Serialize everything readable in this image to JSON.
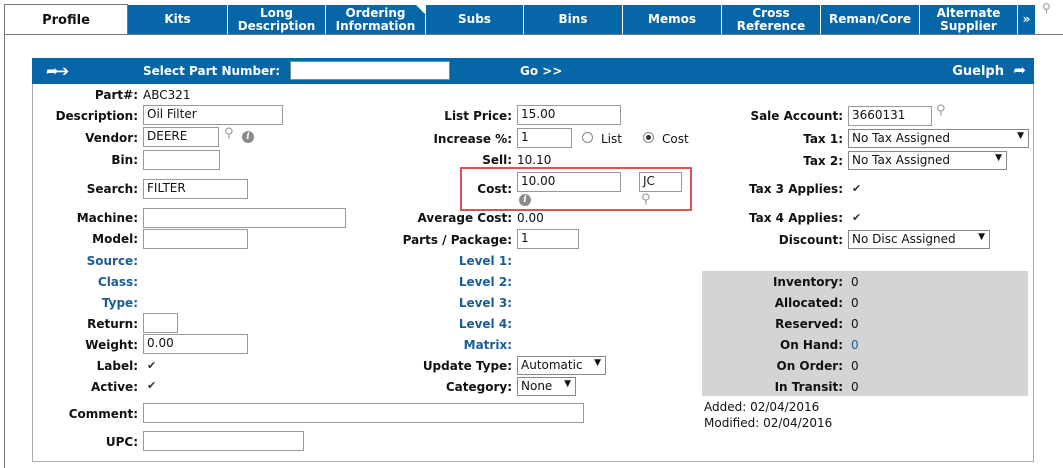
{
  "tabs": [
    {
      "label": "Profile",
      "active": true
    },
    {
      "label": "Kits"
    },
    {
      "line1": "Long",
      "line2": "Description"
    },
    {
      "line1": "Ordering",
      "line2": "Information"
    },
    {
      "label": "Subs"
    },
    {
      "label": "Bins"
    },
    {
      "label": "Memos"
    },
    {
      "line1": "Cross",
      "line2": "Reference"
    },
    {
      "label": "Reman/Core"
    },
    {
      "line1": "Alternate",
      "line2": "Supplier"
    },
    {
      "label": "»"
    }
  ],
  "bar": {
    "select_label": "Select Part Number:",
    "select_value": "",
    "go_label": "Go >>",
    "location": "Guelph"
  },
  "left": {
    "part_label": "Part#:",
    "part_value": "ABC321",
    "description_label": "Description:",
    "description_value": "Oil Filter",
    "vendor_label": "Vendor:",
    "vendor_value": "DEERE",
    "bin_label": "Bin:",
    "bin_value": "",
    "search_label": "Search:",
    "search_value": "FILTER",
    "machine_label": "Machine:",
    "machine_value": "",
    "model_label": "Model:",
    "model_value": "",
    "source_label": "Source:",
    "class_label": "Class:",
    "type_label": "Type:",
    "return_label": "Return:",
    "return_value": "",
    "weight_label": "Weight:",
    "weight_value": "0.00",
    "label_label": "Label:",
    "active_label": "Active:",
    "comment_label": "Comment:",
    "comment_value": "",
    "upc_label": "UPC:",
    "upc_value": ""
  },
  "middle": {
    "list_price_label": "List Price:",
    "list_price_value": "15.00",
    "increase_label": "Increase %:",
    "increase_value": "1",
    "radio_list_label": "List",
    "radio_cost_label": "Cost",
    "sell_label": "Sell:",
    "sell_value": "10.10",
    "cost_label": "Cost:",
    "cost_value": "10.00",
    "cost_code": "JC",
    "avg_cost_label": "Average Cost:",
    "avg_cost_value": "0.00",
    "parts_pkg_label": "Parts / Package:",
    "parts_pkg_value": "1",
    "level1_label": "Level 1:",
    "level2_label": "Level 2:",
    "level3_label": "Level 3:",
    "level4_label": "Level 4:",
    "matrix_label": "Matrix:",
    "update_type_label": "Update Type:",
    "update_type_value": "Automatic",
    "category_label": "Category:",
    "category_value": "None"
  },
  "right": {
    "sale_account_label": "Sale Account:",
    "sale_account_value": "3660131",
    "tax1_label": "Tax 1:",
    "tax1_value": "No Tax Assigned",
    "tax2_label": "Tax 2:",
    "tax2_value": "No Tax Assigned",
    "tax3_label": "Tax 3 Applies:",
    "tax4_label": "Tax 4 Applies:",
    "discount_label": "Discount:",
    "discount_value": "No Disc Assigned",
    "inventory": {
      "inventory_label": "Inventory:",
      "inventory_value": "0",
      "allocated_label": "Allocated:",
      "allocated_value": "0",
      "reserved_label": "Reserved:",
      "reserved_value": "0",
      "onhand_label": "On Hand:",
      "onhand_value": "0",
      "onorder_label": "On Order:",
      "onorder_value": "0",
      "intransit_label": "In Transit:",
      "intransit_value": "0"
    },
    "added": "Added: 02/04/2016",
    "modified": "Modified: 02/04/2016"
  },
  "colors": {
    "tab_blue": "#0766a8",
    "link_blue": "#1a5d94",
    "highlight_red": "#d9534f",
    "inventory_bg": "#d4d4d4"
  }
}
